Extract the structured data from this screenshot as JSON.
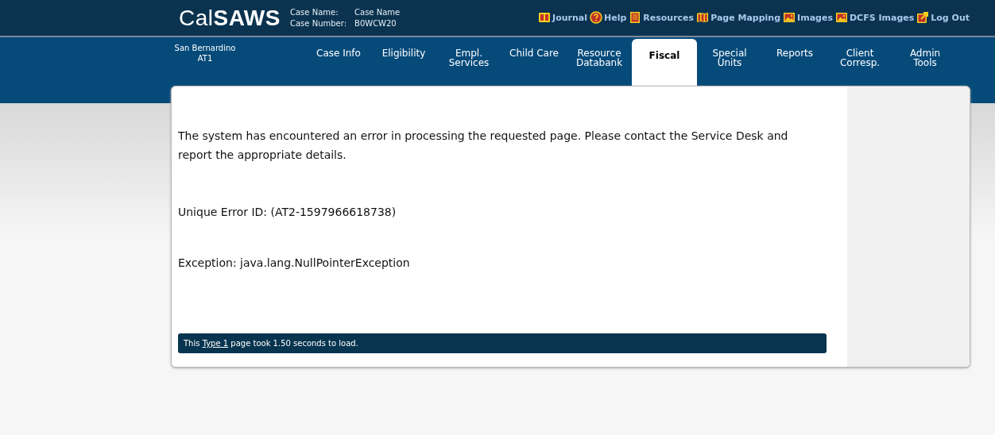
{
  "header": {
    "logo_light": "Cal",
    "logo_bold": "SAWS",
    "case_name_label": "Case Name:",
    "case_name": "Case Name",
    "case_number_label": "Case Number:",
    "case_number": "B0WCW20",
    "links": [
      {
        "label": "Journal"
      },
      {
        "label": "Help"
      },
      {
        "label": "Resources"
      },
      {
        "label": "Page Mapping"
      },
      {
        "label": "Images"
      },
      {
        "label": "DCFS Images"
      },
      {
        "label": "Log Out"
      }
    ]
  },
  "nav": {
    "county": "San Bernardino",
    "office": "AT1",
    "tabs": [
      {
        "label": "Case Info",
        "selected": false
      },
      {
        "label": "Eligibility",
        "selected": false
      },
      {
        "label": "Empl.\nServices",
        "selected": false
      },
      {
        "label": "Child Care",
        "selected": false
      },
      {
        "label": "Resource\nDatabank",
        "selected": false
      },
      {
        "label": "Fiscal",
        "selected": true
      },
      {
        "label": "Special\nUnits",
        "selected": false
      },
      {
        "label": "Reports",
        "selected": false
      },
      {
        "label": "Client\nCorresp.",
        "selected": false
      },
      {
        "label": "Admin\nTools",
        "selected": false
      }
    ]
  },
  "messages": [
    "The system has encountered an error in processing the requested page. Please contact the Service Desk and report the appropriate details.",
    "Unique Error ID: (AT2-1597966618738)",
    "Exception: java.lang.NullPointerException"
  ],
  "footer": {
    "prefix": "This",
    "link": "Type 1",
    "suffix": "page took 1.50 seconds to load."
  }
}
